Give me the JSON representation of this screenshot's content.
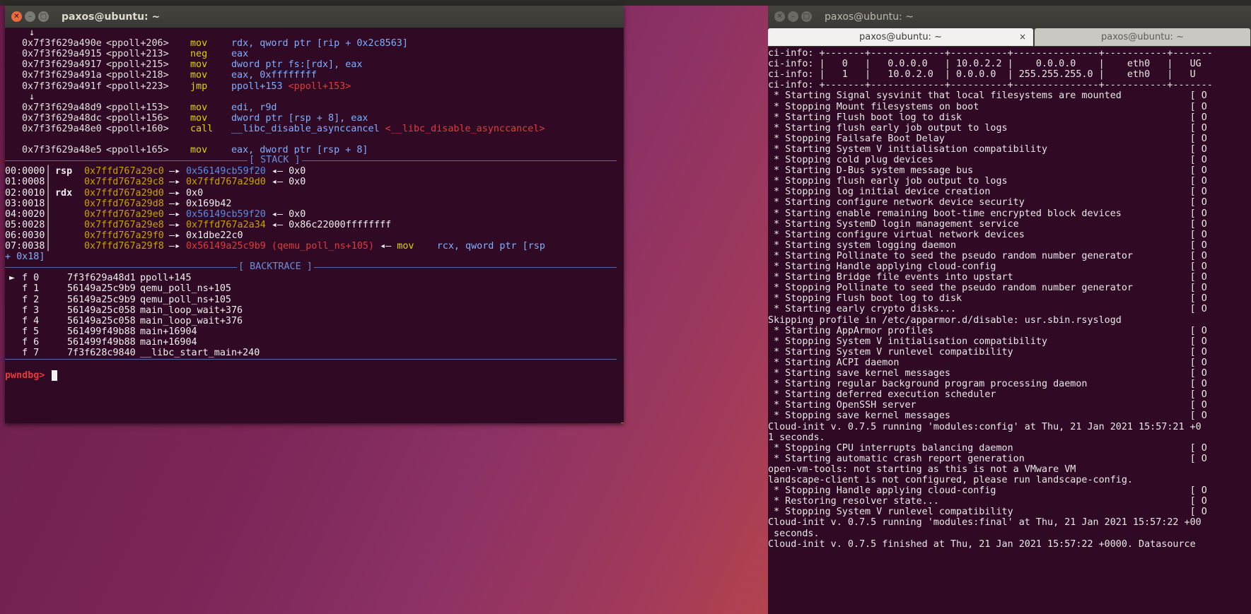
{
  "left_window": {
    "title": "paxos@ubuntu: ~",
    "disasm": [
      {
        "addr": "",
        "sym": "",
        "mn": "",
        "ops": "",
        "arrow": "↓"
      },
      {
        "addr": "0x7f3f629a490e",
        "sym": "<ppoll+206>",
        "mn": "mov",
        "ops": "rdx, qword ptr [rip + 0x2c8563]"
      },
      {
        "addr": "0x7f3f629a4915",
        "sym": "<ppoll+213>",
        "mn": "neg",
        "ops": "eax"
      },
      {
        "addr": "0x7f3f629a4917",
        "sym": "<ppoll+215>",
        "mn": "mov",
        "ops": "dword ptr fs:[rdx], eax"
      },
      {
        "addr": "0x7f3f629a491a",
        "sym": "<ppoll+218>",
        "mn": "mov",
        "ops": "eax, 0xffffffff"
      },
      {
        "addr": "0x7f3f629a491f",
        "sym": "<ppoll+223>",
        "mn": "jmp",
        "ops": "ppoll+153",
        "target": "<ppoll+153>"
      },
      {
        "addr": "",
        "sym": "",
        "mn": "",
        "ops": "",
        "arrow": "↓"
      },
      {
        "addr": "0x7f3f629a48d9",
        "sym": "<ppoll+153>",
        "mn": "mov",
        "ops": "edi, r9d"
      },
      {
        "addr": "0x7f3f629a48dc",
        "sym": "<ppoll+156>",
        "mn": "mov",
        "ops": "dword ptr [rsp + 8], eax"
      },
      {
        "addr": "0x7f3f629a48e0",
        "sym": "<ppoll+160>",
        "mn": "call",
        "ops": "__libc_disable_asynccancel",
        "target": "<__libc_disable_asynccancel>"
      },
      {
        "addr": "",
        "sym": "",
        "mn": "",
        "ops": ""
      },
      {
        "addr": "0x7f3f629a48e5",
        "sym": "<ppoll+165>",
        "mn": "mov",
        "ops": "eax, dword ptr [rsp + 8]"
      }
    ],
    "stack_header": "[ STACK ]",
    "stack": [
      {
        "idx": "00:0000",
        "reg": "rsp",
        "addr": "0x7ffd767a29c0",
        "chain": "0x56149cb59f20",
        "val": "0x0"
      },
      {
        "idx": "01:0008",
        "reg": "",
        "addr": "0x7ffd767a29c8",
        "chain": "0x7ffd767a29d0",
        "val": "0x0"
      },
      {
        "idx": "02:0010",
        "reg": "rdx",
        "addr": "0x7ffd767a29d0",
        "chain": "",
        "val": "0x0"
      },
      {
        "idx": "03:0018",
        "reg": "",
        "addr": "0x7ffd767a29d8",
        "chain": "",
        "val": "0x169b42"
      },
      {
        "idx": "04:0020",
        "reg": "",
        "addr": "0x7ffd767a29e0",
        "chain": "0x56149cb59f20",
        "val": "0x0"
      },
      {
        "idx": "05:0028",
        "reg": "",
        "addr": "0x7ffd767a29e8",
        "chain": "0x7ffd767a2a34",
        "val": "0x86c22000ffffffff"
      },
      {
        "idx": "06:0030",
        "reg": "",
        "addr": "0x7ffd767a29f0",
        "chain": "",
        "val": "0x1dbe22c0"
      },
      {
        "idx": "07:0038",
        "reg": "",
        "addr": "0x7ffd767a29f8",
        "chain": "0x56149a25c9b9 (qemu_poll_ns+105)",
        "val": "mov    rcx, qword ptr [rsp",
        "cont": "+ 0x18]"
      }
    ],
    "backtrace_header": "[ BACKTRACE ]",
    "backtrace": [
      {
        "marker": "►",
        "frame": "f 0",
        "addr": "7f3f629a48d1",
        "fn": "ppoll+145"
      },
      {
        "marker": "",
        "frame": "f 1",
        "addr": "56149a25c9b9",
        "fn": "qemu_poll_ns+105"
      },
      {
        "marker": "",
        "frame": "f 2",
        "addr": "56149a25c9b9",
        "fn": "qemu_poll_ns+105"
      },
      {
        "marker": "",
        "frame": "f 3",
        "addr": "56149a25c058",
        "fn": "main_loop_wait+376"
      },
      {
        "marker": "",
        "frame": "f 4",
        "addr": "56149a25c058",
        "fn": "main_loop_wait+376"
      },
      {
        "marker": "",
        "frame": "f 5",
        "addr": "561499f49b88",
        "fn": "main+16904"
      },
      {
        "marker": "",
        "frame": "f 6",
        "addr": "561499f49b88",
        "fn": "main+16904"
      },
      {
        "marker": "",
        "frame": "f 7",
        "addr": "7f3f628c9840",
        "fn": "__libc_start_main+240"
      }
    ],
    "prompt": "pwndbg>"
  },
  "right_window": {
    "title": "paxos@ubuntu: ~",
    "tabs": [
      {
        "label": "paxos@ubuntu: ~",
        "active": true
      },
      {
        "label": "paxos@ubuntu: ~",
        "active": false
      }
    ],
    "tab_close": "×",
    "lines": [
      "ci-info: +-------+-------------+----------+---------------+-----------+-------",
      "ci-info: |   0   |   0.0.0.0   | 10.0.2.2 |    0.0.0.0    |    eth0   |   UG",
      "ci-info: |   1   |   10.0.2.0  | 0.0.0.0  | 255.255.255.0 |    eth0   |   U",
      "ci-info: +-------+-------------+----------+---------------+-----------+-------",
      " * Starting Signal sysvinit that local filesystems are mounted            [ O",
      " * Stopping Mount filesystems on boot                                     [ O",
      " * Starting Flush boot log to disk                                        [ O",
      " * Starting flush early job output to logs                                [ O",
      " * Stopping Failsafe Boot Delay                                           [ O",
      " * Starting System V initialisation compatibility                         [ O",
      " * Stopping cold plug devices                                             [ O",
      " * Starting D-Bus system message bus                                      [ O",
      " * Stopping flush early job output to logs                                [ O",
      " * Stopping log initial device creation                                   [ O",
      " * Starting configure network device security                             [ O",
      " * Starting enable remaining boot-time encrypted block devices            [ O",
      " * Starting SystemD login management service                              [ O",
      " * Starting configure virtual network devices                             [ O",
      " * Starting system logging daemon                                         [ O",
      " * Starting Pollinate to seed the pseudo random number generator          [ O",
      " * Starting Handle applying cloud-config                                  [ O",
      " * Starting Bridge file events into upstart                               [ O",
      " * Stopping Pollinate to seed the pseudo random number generator          [ O",
      " * Stopping Flush boot log to disk                                        [ O",
      " * Starting early crypto disks...                                         [ O",
      "Skipping profile in /etc/apparmor.d/disable: usr.sbin.rsyslogd",
      " * Starting AppArmor profiles                                             [ O",
      " * Stopping System V initialisation compatibility                         [ O",
      " * Starting System V runlevel compatibility                               [ O",
      " * Starting ACPI daemon                                                   [ O",
      " * Starting save kernel messages                                          [ O",
      " * Starting regular background program processing daemon                  [ O",
      " * Starting deferred execution scheduler                                  [ O",
      " * Starting OpenSSH server                                                [ O",
      " * Stopping save kernel messages                                          [ O",
      "Cloud-init v. 0.7.5 running 'modules:config' at Thu, 21 Jan 2021 15:57:21 +0",
      "1 seconds.",
      " * Stopping CPU interrupts balancing daemon                               [ O",
      " * Starting automatic crash report generation                             [ O",
      "open-vm-tools: not starting as this is not a VMware VM",
      "landscape-client is not configured, please run landscape-config.",
      " * Stopping Handle applying cloud-config                                  [ O",
      " * Restoring resolver state...                                            [ O",
      " * Stopping System V runlevel compatibility                               [ O",
      "Cloud-init v. 0.7.5 running 'modules:final' at Thu, 21 Jan 2021 15:57:22 +00",
      " seconds.",
      "Cloud-init v. 0.7.5 finished at Thu, 21 Jan 2021 15:57:22 +0000. Datasource"
    ]
  },
  "colors": {
    "terminal_bg": "#300a24",
    "mnemonic": "#d8d800",
    "operand": "#7fb0ff",
    "symbol_red": "#e23b3b",
    "stack_addr": "#c9a300",
    "heap_ptr": "#5c8ce6",
    "header": "#6a8ed8",
    "accent": "#e06a2c"
  }
}
